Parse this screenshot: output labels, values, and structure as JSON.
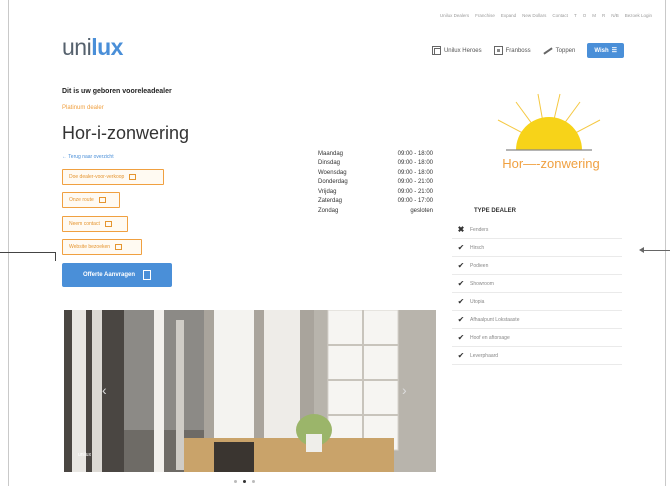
{
  "top_links": [
    "Unilux Dealers",
    "Franchise",
    "Expand",
    "New Dollars",
    "Contact",
    "T",
    "O",
    "M",
    "R",
    "N/B",
    "Bezoek Login"
  ],
  "logo": {
    "part1": "uni",
    "part2": "lux"
  },
  "nav": {
    "items": [
      "Unilux Heroes",
      "Franboss",
      "Toppen"
    ],
    "wish_label": "Wish"
  },
  "dealer": {
    "intro": "Dit is uw geboren vooreleadealer",
    "subtitle": "Platinum dealer",
    "name": "Hor-i-zonwering",
    "back_link": "← Terug naar overzicht",
    "buttons": [
      "Doe dealer-voor-verkoop",
      "Onze route",
      "Neem contact",
      "Website bezoeken"
    ],
    "offer_button": "Offerte Aanvragen"
  },
  "hours": [
    {
      "day": "Maandag",
      "time": "09:00 - 18:00"
    },
    {
      "day": "Dinsdag",
      "time": "09:00 - 18:00"
    },
    {
      "day": "Woensdag",
      "time": "09:00 - 18:00"
    },
    {
      "day": "Donderdag",
      "time": "09:00 - 21:00"
    },
    {
      "day": "Vrijdag",
      "time": "09:00 - 21:00"
    },
    {
      "day": "Zaterdag",
      "time": "09:00 - 17:00"
    },
    {
      "day": "Zondag",
      "time": "gesloten"
    }
  ],
  "brand_logo_text": "Hor—-zonwering",
  "dealer_type": {
    "title": "TYPE DEALER",
    "items": [
      {
        "mark": "x",
        "label": "Fenders"
      },
      {
        "mark": "check",
        "label": "Hirsch"
      },
      {
        "mark": "check",
        "label": "Podieen"
      },
      {
        "mark": "check",
        "label": "Showroom"
      },
      {
        "mark": "check",
        "label": "Utopia"
      },
      {
        "mark": "check",
        "label": "Afhaalpunt Lokstaaste"
      },
      {
        "mark": "check",
        "label": "Hoof en aftorsage"
      },
      {
        "mark": "check",
        "label": "Leverphaard"
      }
    ]
  },
  "photo": {
    "label": "unilux",
    "prev": "‹",
    "next": "›"
  },
  "colors": {
    "accent": "#4a8fd8",
    "orange": "#f0a040"
  }
}
